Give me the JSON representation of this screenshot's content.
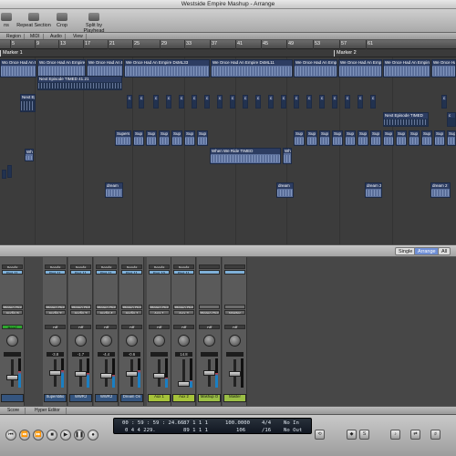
{
  "window": {
    "title": "Westside Empire Mashup - Arrange"
  },
  "toolbar": {
    "buttons": [
      {
        "id": "toolbar-button-automation",
        "label": "ns"
      },
      {
        "id": "toolbar-button-repeat-section",
        "label": "Repeat Section"
      },
      {
        "id": "toolbar-button-crop",
        "label": "Crop"
      },
      {
        "id": "toolbar-button-split-by-playhead",
        "label": "Split by Playhead"
      }
    ]
  },
  "local_menu": {
    "items": [
      "Region",
      "MIDI",
      "Audio",
      "View"
    ]
  },
  "ruler": {
    "bars": [
      "5",
      "9",
      "13",
      "17",
      "21",
      "25",
      "29",
      "33",
      "37",
      "41",
      "45",
      "49",
      "53",
      "57",
      "61"
    ]
  },
  "markers": [
    "Marker 1",
    "Marker 2"
  ],
  "regions": {
    "wonce_1": "Wo Once Had An Empire",
    "wonce_2": "Wo Once Had An Empire",
    "wonce_3": "We Once Had An Empire",
    "wonce_4": "We Once Had An Empire DsML33",
    "wonce_5": "We Once Had An Empire DsML11",
    "wonce_6": "We Once Had An Empire",
    "wonce_7": "We Once Had An Empire",
    "wonce_8": "We Once Had An Empire",
    "next_1": "Next Episode TIMED 41.21",
    "next_small": "Next Ep",
    "next_2": "Next Episode TIMED",
    "c": "c",
    "supers": "Supers",
    "sup": "Sup",
    "when": "When We Ride TIMED",
    "when_small": "Whe",
    "dream": "dream",
    "dream_2": "dream 2"
  },
  "mixer": {
    "tabs": [
      "Single",
      "Arrange",
      "All"
    ],
    "strips": [
      {
        "sends": "Sends",
        "bus": "Bus 11",
        "io": "Stereo Out",
        "input": "Audio 9",
        "auto": "Read",
        "value": "",
        "name": "",
        "fader": 0.45,
        "meter": 0.55
      },
      {
        "sends": "Sends",
        "bus": "Bus 11",
        "io": "Stereo Out",
        "input": "Audio 2",
        "auto": "Off",
        "value": "-3.8",
        "name": "Superstitio",
        "fader": 0.6,
        "meter": 0.6
      },
      {
        "sends": "Sends",
        "bus": "Bus 11",
        "io": "Stereo Out",
        "input": "Audio 3",
        "auto": "Off",
        "value": "-1.7",
        "name": "WWRJ",
        "fader": 0.55,
        "meter": 0.5
      },
      {
        "sends": "Sends",
        "bus": "Bus 11",
        "io": "Stereo Out",
        "input": "Audio 4",
        "auto": "Off",
        "value": "-4.4",
        "name": "WWRJ",
        "fader": 0.5,
        "meter": 0.45
      },
      {
        "sends": "Sends",
        "bus": "Bus 11",
        "io": "Stereo Out",
        "input": "Audio 1",
        "auto": "Off",
        "value": "-0.6",
        "name": "Dream On",
        "fader": 0.55,
        "meter": 0.6
      },
      {
        "sends": "Sends",
        "bus": "Bus 10",
        "io": "Stereo Out",
        "input": "Aux 1",
        "auto": "Off",
        "value": "",
        "name": "Aux 1",
        "fader": 0.5,
        "meter": 0.35
      },
      {
        "sends": "Sends",
        "bus": "Bus 11",
        "io": "Stereo Out",
        "input": "Aux 2",
        "auto": "Off",
        "value": "14.8",
        "name": "Aux 2",
        "fader": 0.2,
        "meter": 0.25
      },
      {
        "sends": "",
        "bus": "",
        "io": "",
        "input": "Stereo Out",
        "auto": "Off",
        "value": "",
        "name": "Mashup O",
        "fader": 0.6,
        "meter": 0.5
      },
      {
        "sends": "",
        "bus": "",
        "io": "",
        "input": "Master",
        "auto": "Off",
        "value": "",
        "name": "Master",
        "fader": 0.55,
        "meter": 0.0
      }
    ]
  },
  "bottom_tabs": [
    "Score",
    "Hyper Editor"
  ],
  "transport": {
    "time": "00 : 59 : 59 : 24.66",
    "bars": "0 4 4 229.",
    "bpm_row1": "87  1  1  1",
    "bpm_row2": "89  1  1  1",
    "tempo": "100.0000",
    "tempo2": "106",
    "sig": "4/4",
    "div": "/16",
    "in": "No In",
    "out": "No Out"
  },
  "colors": {
    "region": "#5b6f9a",
    "region_header": "#2d3d62",
    "aux": "#a6c33a",
    "accent": "#6f8fd6"
  }
}
